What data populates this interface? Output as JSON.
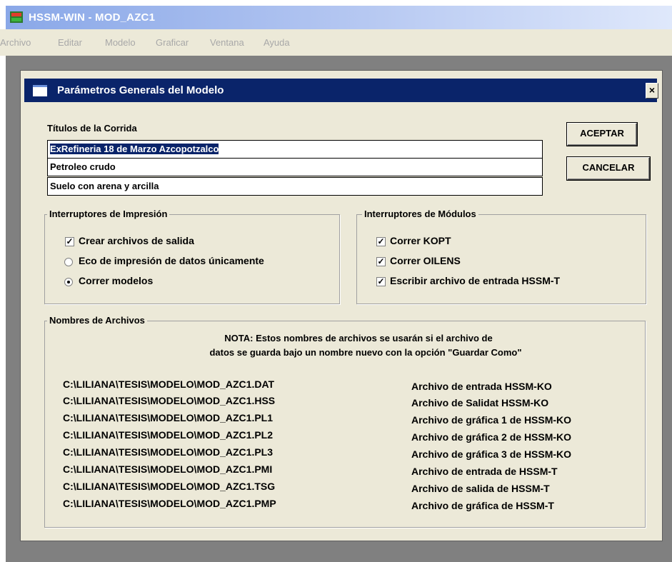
{
  "app": {
    "title": "HSSM-WIN - MOD_AZC1",
    "menu": [
      "Archivo",
      "Editar",
      "Modelo",
      "Graficar",
      "Ventana",
      "Ayuda"
    ]
  },
  "dialog": {
    "title": "Parámetros Generals del Modelo",
    "close_label": "×",
    "titles_label": "Títulos de la Corrida",
    "titles": [
      "ExRefineria 18 de Marzo Azcopotzalco",
      "Petroleo crudo",
      "Suelo con arena y arcilla"
    ],
    "accept_label": "ACEPTAR",
    "cancel_label": "CANCELAR",
    "print_switches": {
      "legend": "Interruptores de Impresión",
      "create_output": {
        "label": "Crear archivos de salida",
        "checked": true
      },
      "echo_only": {
        "label": "Eco de impresión de datos únicamente",
        "selected": false
      },
      "run_models": {
        "label": "Correr modelos",
        "selected": true
      }
    },
    "module_switches": {
      "legend": "Interruptores de Módulos",
      "items": [
        {
          "label": "Correr KOPT",
          "checked": true
        },
        {
          "label": "Correr OILENS",
          "checked": true
        },
        {
          "label": "Escribir archivo de entrada HSSM-T",
          "checked": true
        }
      ]
    },
    "files": {
      "legend": "Nombres de Archivos",
      "note_line1": "NOTA: Estos nombres de archivos se usarán si el archivo de",
      "note_line2": "datos se guarda bajo un nombre nuevo con la opción \"Guardar Como\"",
      "rows": [
        {
          "path": "C:\\LILIANA\\TESIS\\MODELO\\MOD_AZC1.DAT",
          "desc": "Archivo de entrada HSSM-KO"
        },
        {
          "path": "C:\\LILIANA\\TESIS\\MODELO\\MOD_AZC1.HSS",
          "desc": "Archivo de Salidat HSSM-KO"
        },
        {
          "path": "C:\\LILIANA\\TESIS\\MODELO\\MOD_AZC1.PL1",
          "desc": "Archivo de gráfica 1 de HSSM-KO"
        },
        {
          "path": "C:\\LILIANA\\TESIS\\MODELO\\MOD_AZC1.PL2",
          "desc": "Archivo de gráfica 2 de HSSM-KO"
        },
        {
          "path": "C:\\LILIANA\\TESIS\\MODELO\\MOD_AZC1.PL3",
          "desc": "Archivo de gráfica 3 de HSSM-KO"
        },
        {
          "path": "C:\\LILIANA\\TESIS\\MODELO\\MOD_AZC1.PMI",
          "desc": "Archivo de entrada de HSSM-T"
        },
        {
          "path": "C:\\LILIANA\\TESIS\\MODELO\\MOD_AZC1.TSG",
          "desc": "Archivo de salida de HSSM-T"
        },
        {
          "path": "C:\\LILIANA\\TESIS\\MODELO\\MOD_AZC1.PMP",
          "desc": "Archivo de gráfica de HSSM-T"
        }
      ]
    }
  },
  "colors": {
    "dialog_titlebar": "#0a246a",
    "face": "#ece9d8",
    "workspace": "#808080"
  }
}
